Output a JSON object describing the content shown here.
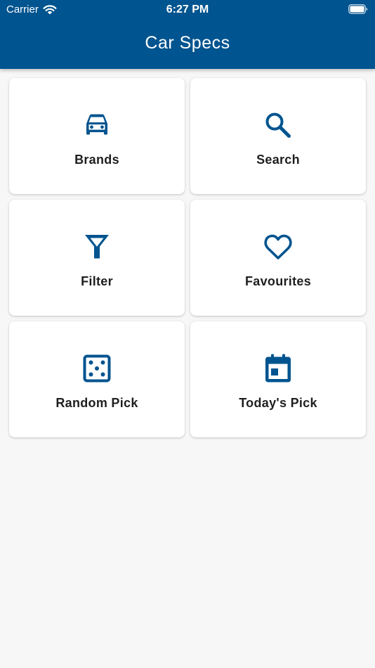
{
  "status_bar": {
    "carrier": "Carrier",
    "time": "6:27 PM",
    "wifi_icon": "wifi-icon",
    "battery_icon": "battery-icon"
  },
  "app_bar": {
    "title": "Car Specs",
    "color": "#00548f"
  },
  "menu": {
    "icon_color": "#00548f",
    "tiles": [
      {
        "label": "Brands",
        "icon": "car-icon"
      },
      {
        "label": "Search",
        "icon": "search-icon"
      },
      {
        "label": "Filter",
        "icon": "filter-icon"
      },
      {
        "label": "Favourites",
        "icon": "heart-icon"
      },
      {
        "label": "Random Pick",
        "icon": "dice-icon"
      },
      {
        "label": "Today's Pick",
        "icon": "calendar-icon"
      }
    ]
  }
}
